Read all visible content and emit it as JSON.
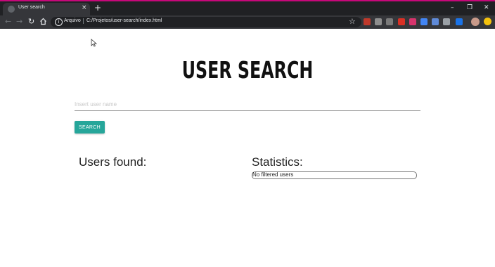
{
  "browser": {
    "tab_title": "User search",
    "tab_close": "×",
    "new_tab": "+",
    "window_controls": [
      "–",
      "❐",
      "✕"
    ],
    "omnibox_scheme": "Arquivo",
    "omnibox_separator": "|",
    "omnibox_url": "C:/Projetos/user-search/index.html",
    "accent_color": "#c6087a",
    "extensions": [
      {
        "name": "ext-k-icon",
        "color": "#c0392b"
      },
      {
        "name": "ext-pin-icon",
        "color": "#8e8e8e"
      },
      {
        "name": "ext-gray-icon",
        "color": "#7a7a7a"
      },
      {
        "name": "ext-red-icon",
        "color": "#d93025"
      },
      {
        "name": "ext-pink-icon",
        "color": "#d6336c"
      },
      {
        "name": "ext-blue-icon",
        "color": "#4285f4"
      },
      {
        "name": "ext-translate-icon",
        "color": "#5f8ad8"
      },
      {
        "name": "ext-gear-icon",
        "color": "#9aa0a6"
      },
      {
        "name": "ext-dark-icon",
        "color": "#3c4043"
      },
      {
        "name": "ext-puzzle-icon",
        "color": "#1a73e8"
      }
    ]
  },
  "page": {
    "title": "USER SEARCH",
    "search_placeholder": "Insert user name",
    "search_button": "SEARCH",
    "users_heading": "Users found:",
    "stats_heading": "Statistics:",
    "stats_empty": "No filtered users"
  }
}
